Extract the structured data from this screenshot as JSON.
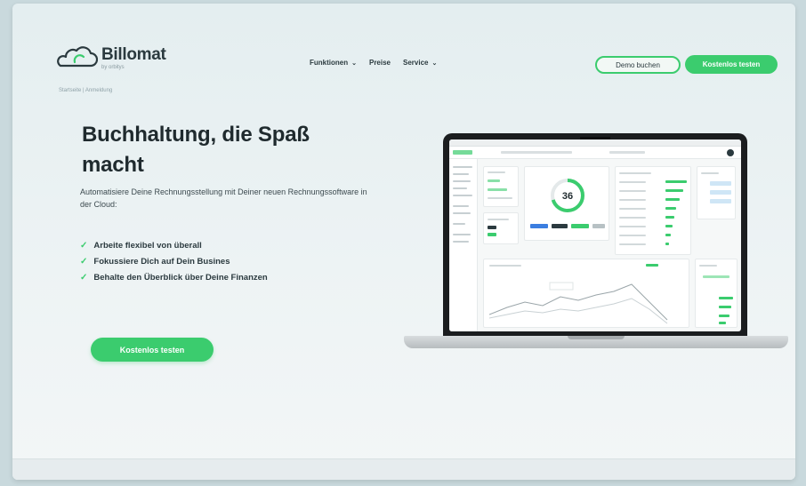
{
  "brand": {
    "name": "Billomat",
    "sub": "by orbitys"
  },
  "breadcrumb": "Startseite | Anmeldung",
  "nav": {
    "items": [
      "Funktionen",
      "Preise",
      "Service"
    ]
  },
  "header_buttons": {
    "demo": "Demo buchen",
    "trial": "Kostenlos testen"
  },
  "hero": {
    "title": "Buchhaltung, die Spaß macht",
    "description": "Automatisiere Deine Rechnungsstellung mit Deiner neuen Rechnungssoftware in der Cloud:",
    "features": [
      "Arbeite flexibel von überall",
      "Fokussiere Dich auf Dein Busines",
      "Behalte den Überblick über Deine Finanzen"
    ],
    "cta": "Kostenlos testen"
  },
  "laptop_screen": {
    "gauge_value": "36"
  },
  "colors": {
    "accent": "#3bcc6e",
    "text_dark": "#1f2a2e",
    "background": "#e4eef0"
  },
  "icons": [
    "cloud-logo-icon",
    "chevron-down-icon",
    "check-icon"
  ]
}
